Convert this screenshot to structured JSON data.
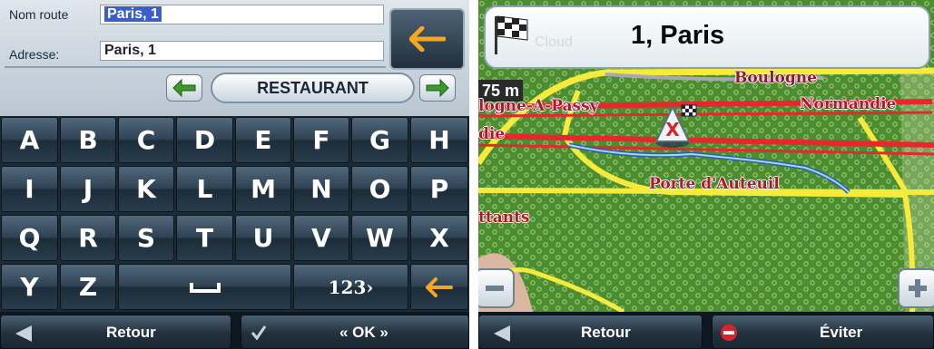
{
  "left_screen": {
    "form": {
      "route_name_label": "Nom route",
      "route_name_value": "Paris, 1",
      "address_label": "Adresse:",
      "address_value": "Paris, 1",
      "back_icon": "left-arrow-icon"
    },
    "category": {
      "label": "RESTAURANT",
      "prev_icon": "left-arrow-icon",
      "next_icon": "right-arrow-icon"
    },
    "keyboard": {
      "rows": [
        [
          "A",
          "B",
          "C",
          "D",
          "E",
          "F",
          "G",
          "H"
        ],
        [
          "I",
          "J",
          "K",
          "L",
          "M",
          "N",
          "O",
          "P"
        ],
        [
          "Q",
          "R",
          "S",
          "T",
          "U",
          "V",
          "W",
          "X"
        ]
      ],
      "last_row": {
        "y": "Y",
        "z": "Z",
        "space_icon": "space-bar-icon",
        "numbers_label": "123›",
        "backspace_icon": "backspace-arrow-icon"
      }
    },
    "bottom": {
      "back_label": "Retour",
      "ok_label": "« OK »"
    }
  },
  "right_screen": {
    "header": {
      "destination": "1, Paris",
      "ghost_text": "Cloud",
      "flag_icon": "checkered-flag-icon"
    },
    "map": {
      "scale": "75 m",
      "streets": {
        "boulogne": "Boulogne",
        "normandie": "Normandie",
        "passy": "logne-A-Passy",
        "die": "die",
        "porte": "Porte d'Auteuil",
        "ttants": "ttants"
      }
    },
    "bottom": {
      "back_label": "Retour",
      "avoid_label": "Éviter"
    }
  },
  "colors": {
    "accent_arrow": "#f5a623",
    "green_arrow": "#3c9a2c",
    "map_green": "#4c8e2f",
    "road_red": "#e8262e",
    "road_yellow": "#f6ea3a"
  }
}
